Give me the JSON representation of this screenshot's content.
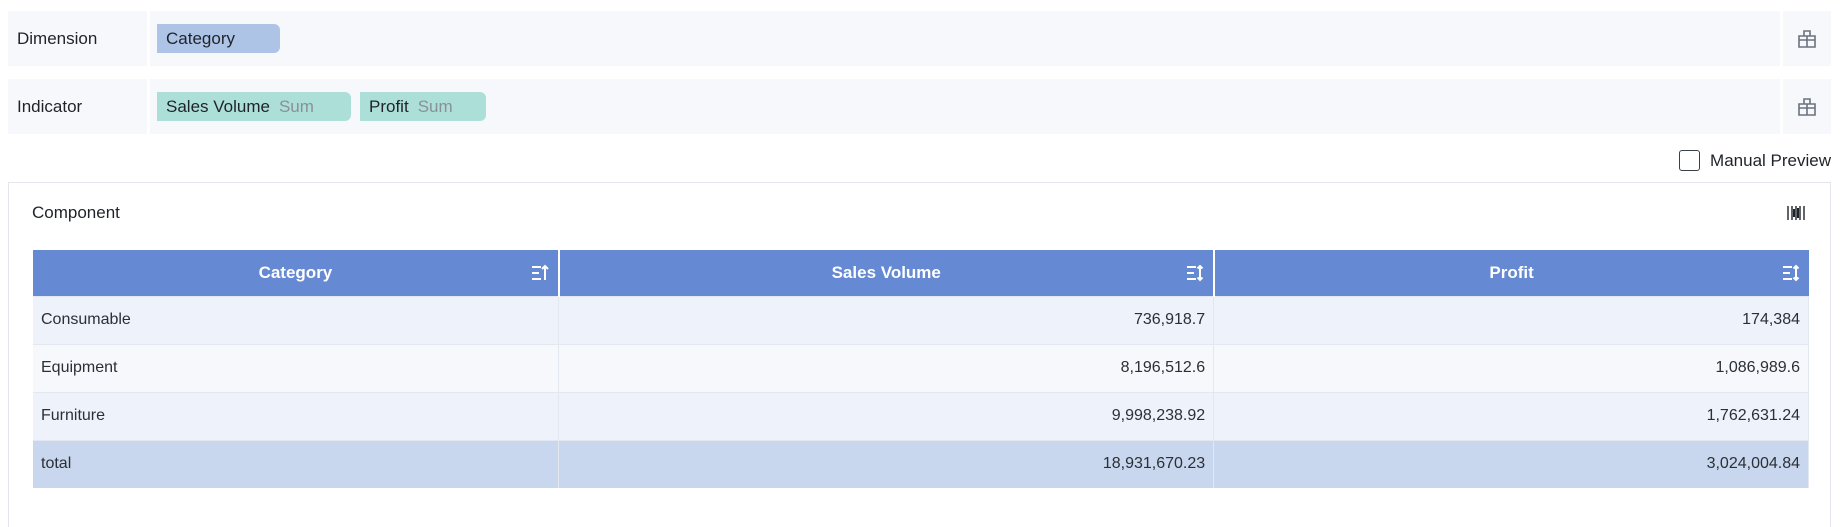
{
  "dimension": {
    "label": "Dimension",
    "fields": [
      {
        "name": "Category"
      }
    ]
  },
  "indicator": {
    "label": "Indicator",
    "fields": [
      {
        "name": "Sales Volume",
        "agg": "Sum"
      },
      {
        "name": "Profit",
        "agg": "Sum"
      }
    ]
  },
  "preview": {
    "label": "Manual Preview",
    "checked": false
  },
  "component": {
    "title": "Component",
    "columns": [
      "Category",
      "Sales Volume",
      "Profit"
    ],
    "rows": [
      [
        "Consumable",
        "736,918.7",
        "174,384"
      ],
      [
        "Equipment",
        "8,196,512.6",
        "1,086,989.6"
      ],
      [
        "Furniture",
        "9,998,238.92",
        "1,762,631.24"
      ]
    ],
    "total": [
      "total",
      "18,931,670.23",
      "3,024,004.84"
    ]
  },
  "colors": {
    "header": "#6589d2",
    "dim_chip": "#aec4e7",
    "ind_chip": "#addfd9",
    "total_row": "#c8d6ee"
  }
}
